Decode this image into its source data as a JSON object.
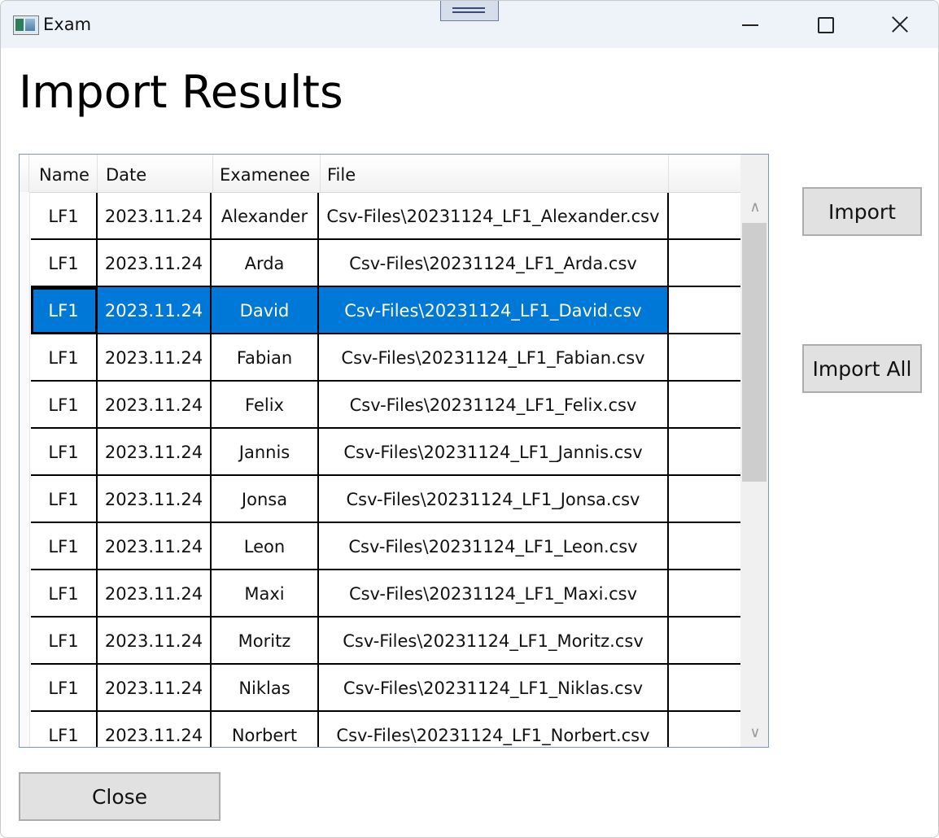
{
  "window": {
    "title": "Exam",
    "minimize_icon": "minimize-icon",
    "maximize_icon": "maximize-icon",
    "close_icon": "close-icon"
  },
  "page": {
    "heading": "Import Results"
  },
  "grid": {
    "columns": [
      "Name",
      "Date",
      "Examenee",
      "File"
    ],
    "rows": [
      [
        "LF1",
        "2023.11.24",
        "Alexander",
        "Csv-Files\\20231124_LF1_Alexander.csv"
      ],
      [
        "LF1",
        "2023.11.24",
        "Arda",
        "Csv-Files\\20231124_LF1_Arda.csv"
      ],
      [
        "LF1",
        "2023.11.24",
        "David",
        "Csv-Files\\20231124_LF1_David.csv"
      ],
      [
        "LF1",
        "2023.11.24",
        "Fabian",
        "Csv-Files\\20231124_LF1_Fabian.csv"
      ],
      [
        "LF1",
        "2023.11.24",
        "Felix",
        "Csv-Files\\20231124_LF1_Felix.csv"
      ],
      [
        "LF1",
        "2023.11.24",
        "Jannis",
        "Csv-Files\\20231124_LF1_Jannis.csv"
      ],
      [
        "LF1",
        "2023.11.24",
        "Jonsa",
        "Csv-Files\\20231124_LF1_Jonsa.csv"
      ],
      [
        "LF1",
        "2023.11.24",
        "Leon",
        "Csv-Files\\20231124_LF1_Leon.csv"
      ],
      [
        "LF1",
        "2023.11.24",
        "Maxi",
        "Csv-Files\\20231124_LF1_Maxi.csv"
      ],
      [
        "LF1",
        "2023.11.24",
        "Moritz",
        "Csv-Files\\20231124_LF1_Moritz.csv"
      ],
      [
        "LF1",
        "2023.11.24",
        "Niklas",
        "Csv-Files\\20231124_LF1_Niklas.csv"
      ],
      [
        "LF1",
        "2023.11.24",
        "Norbert",
        "Csv-Files\\20231124_LF1_Norbert.csv"
      ]
    ],
    "selected_row": 2,
    "scroll_position": 0.0
  },
  "buttons": {
    "import": "Import",
    "import_all": "Import All",
    "close": "Close"
  },
  "colors": {
    "selection": "#0078d7",
    "titlebar": "#eef2f9",
    "button_face": "#e1e1e1"
  }
}
